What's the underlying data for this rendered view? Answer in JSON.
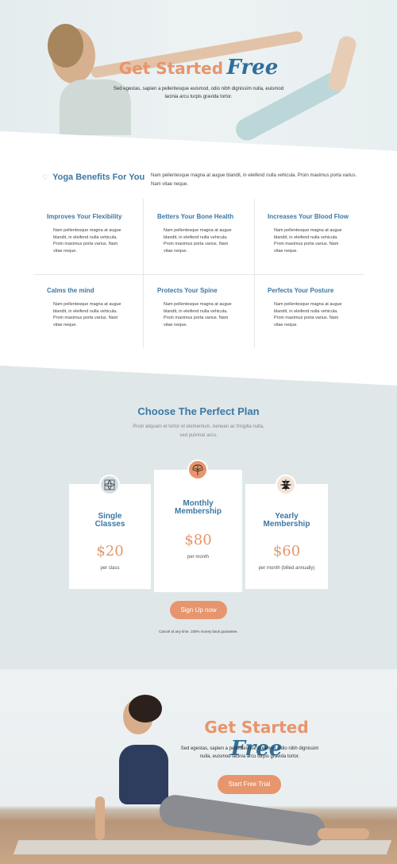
{
  "hero_top": {
    "title": "Get Started",
    "title_accent": "Free",
    "text": "Sed egestas, sapien a pellentesque euismod, odio nibh dignissim nulla, euismod lacinia arcu turpis gravida tortor."
  },
  "benefits": {
    "heading": "Yoga Benefits For You",
    "intro": "Nam pellentesque magna at augue blandit, in eleifend nulla vehicula. Proin maximus porta varius. Nam vitae neque.",
    "items": [
      {
        "title": "Improves Your Flexibility",
        "text": "Nam pellentesque magna at augue blandit, in eleifend nulla vehicula. Proin maximus porta varius. Nam vitae neque."
      },
      {
        "title": "Betters Your Bone Health",
        "text": "Nam pellentesque magna at augue blandit, in eleifend nulla vehicula. Proin maximus porta varius. Nam vitae neque."
      },
      {
        "title": "Increases Your Blood Flow",
        "text": "Nam pellentesque magna at augue blandit, in eleifend nulla vehicula. Proin maximus porta varius. Nam vitae neque."
      },
      {
        "title": "Calms the mind",
        "text": "Nam pellentesque magna at augue blandit, in eleifend nulla vehicula. Proin maximus porta varius. Nam vitae neque."
      },
      {
        "title": "Protects Your Spine",
        "text": "Nam pellentesque magna at augue blandit, in eleifend nulla vehicula. Proin maximus porta varius. Nam vitae neque."
      },
      {
        "title": "Perfects Your Posture",
        "text": "Nam pellentesque magna at augue blandit, in eleifend nulla vehicula. Proin maximus porta varius. Nam vitae neque."
      }
    ]
  },
  "pricing": {
    "heading": "Choose The Perfect Plan",
    "subtext": "Proin aliquam et tortor et elementum. Aenean ac fringilla nulla, sed pulvinar arcu.",
    "plans": [
      {
        "name_line1": "Single",
        "name_line2": "Classes",
        "price": "$20",
        "period": "per class",
        "icon": "flower-tile-icon"
      },
      {
        "name_line1": "Monthly",
        "name_line2": "Membership",
        "price": "$80",
        "period": "per month",
        "icon": "leaf-icon"
      },
      {
        "name_line1": "Yearly",
        "name_line2": "Membership",
        "price": "$60",
        "period": "per month (billed annually)",
        "icon": "lotus-star-icon"
      }
    ],
    "signup_label": "Sign Up now",
    "guarantee": "Cancel at any time. 100% money back guarantee."
  },
  "hero_bottom": {
    "title": "Get Started",
    "title_accent": "Free",
    "text": "Sed egestas, sapien a pellentesque euismod, odio nibh dignissim nulla, euismod lacinia arcu turpis gravida tortor.",
    "button_label": "Start Free Trial"
  },
  "colors": {
    "accent": "#e7956c",
    "heading_blue": "#3d78a3",
    "section_bg": "#dfe7e9"
  }
}
